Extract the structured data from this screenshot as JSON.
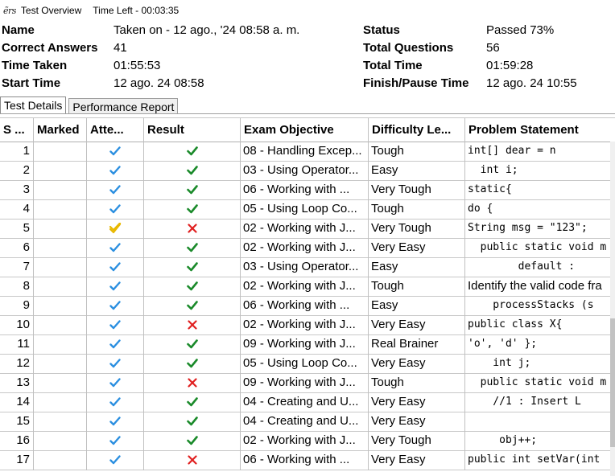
{
  "window": {
    "logo": "ẽrs",
    "title": "Test Overview",
    "time_left": "Time Left - 00:03:35"
  },
  "summary": {
    "name_label": "Name",
    "name_value": "Taken on - 12 ago., '24 08:58 a. m.",
    "status_label": "Status",
    "status_value": "Passed 73%",
    "correct_label": "Correct Answers",
    "correct_value": "41",
    "total_q_label": "Total Questions",
    "total_q_value": "56",
    "time_taken_label": "Time Taken",
    "time_taken_value": "01:55:53",
    "total_time_label": "Total Time",
    "total_time_value": "01:59:28",
    "start_label": "Start Time",
    "start_value": "12 ago. 24 08:58",
    "finish_label": "Finish/Pause Time",
    "finish_value": "12 ago. 24 10:55"
  },
  "tabs": [
    "Test Details",
    "Performance Report"
  ],
  "columns": [
    "S ...",
    "Marked",
    "Atte...",
    "Result",
    "Exam Objective",
    "Difficulty Le...",
    "Problem Statement"
  ],
  "colors": {
    "tick": "#2b8fe0",
    "tick_yellow": "#e8b800",
    "correct": "#1a8a2a",
    "wrong": "#e02020"
  },
  "rows": [
    {
      "sn": "1",
      "attempt": "blue",
      "result": "correct",
      "objective": "08 - Handling Excep...",
      "difficulty": "Tough",
      "problem": "int[] dear = n",
      "mono": true
    },
    {
      "sn": "2",
      "attempt": "blue",
      "result": "correct",
      "objective": "03 - Using Operator...",
      "difficulty": "Easy",
      "problem": "  int i;",
      "mono": true
    },
    {
      "sn": "3",
      "attempt": "blue",
      "result": "correct",
      "objective": "06 - Working with ...",
      "difficulty": "Very Tough",
      "problem": "static{",
      "mono": true
    },
    {
      "sn": "4",
      "attempt": "blue",
      "result": "correct",
      "objective": "05 - Using Loop Co...",
      "difficulty": "Tough",
      "problem": "do {",
      "mono": true
    },
    {
      "sn": "5",
      "attempt": "yellow",
      "result": "wrong",
      "objective": "02 - Working with J...",
      "difficulty": "Very Tough",
      "problem": "String msg = \"123\";",
      "mono": true
    },
    {
      "sn": "6",
      "attempt": "blue",
      "result": "correct",
      "objective": "02 - Working with J...",
      "difficulty": "Very Easy",
      "problem": "  public static void m",
      "mono": true
    },
    {
      "sn": "7",
      "attempt": "blue",
      "result": "correct",
      "objective": "03 - Using Operator...",
      "difficulty": "Easy",
      "problem": "        default :",
      "mono": true
    },
    {
      "sn": "8",
      "attempt": "blue",
      "result": "correct",
      "objective": "02 - Working with J...",
      "difficulty": "Tough",
      "problem": "Identify the valid code fra",
      "mono": false
    },
    {
      "sn": "9",
      "attempt": "blue",
      "result": "correct",
      "objective": "06 - Working with ...",
      "difficulty": "Easy",
      "problem": "    processStacks (s",
      "mono": true
    },
    {
      "sn": "10",
      "attempt": "blue",
      "result": "wrong",
      "objective": "02 - Working with J...",
      "difficulty": "Very Easy",
      "problem": "public class X{",
      "mono": true
    },
    {
      "sn": "11",
      "attempt": "blue",
      "result": "correct",
      "objective": "09 - Working with J...",
      "difficulty": "Real Brainer",
      "problem": "'o', 'd' };",
      "mono": true
    },
    {
      "sn": "12",
      "attempt": "blue",
      "result": "correct",
      "objective": "05 - Using Loop Co...",
      "difficulty": "Very Easy",
      "problem": "    int j;",
      "mono": true
    },
    {
      "sn": "13",
      "attempt": "blue",
      "result": "wrong",
      "objective": "09 - Working with J...",
      "difficulty": "Tough",
      "problem": "  public static void m",
      "mono": true
    },
    {
      "sn": "14",
      "attempt": "blue",
      "result": "correct",
      "objective": "04 - Creating and U...",
      "difficulty": "Very Easy",
      "problem": "    //1 : Insert L",
      "mono": true
    },
    {
      "sn": "15",
      "attempt": "blue",
      "result": "correct",
      "objective": "04 - Creating and U...",
      "difficulty": "Very Easy",
      "problem": "",
      "mono": true
    },
    {
      "sn": "16",
      "attempt": "blue",
      "result": "correct",
      "objective": "02 - Working with J...",
      "difficulty": "Very Tough",
      "problem": "     obj++;",
      "mono": true
    },
    {
      "sn": "17",
      "attempt": "blue",
      "result": "wrong",
      "objective": "06 - Working with ...",
      "difficulty": "Very Easy",
      "problem": "public int setVar(int",
      "mono": true
    }
  ]
}
